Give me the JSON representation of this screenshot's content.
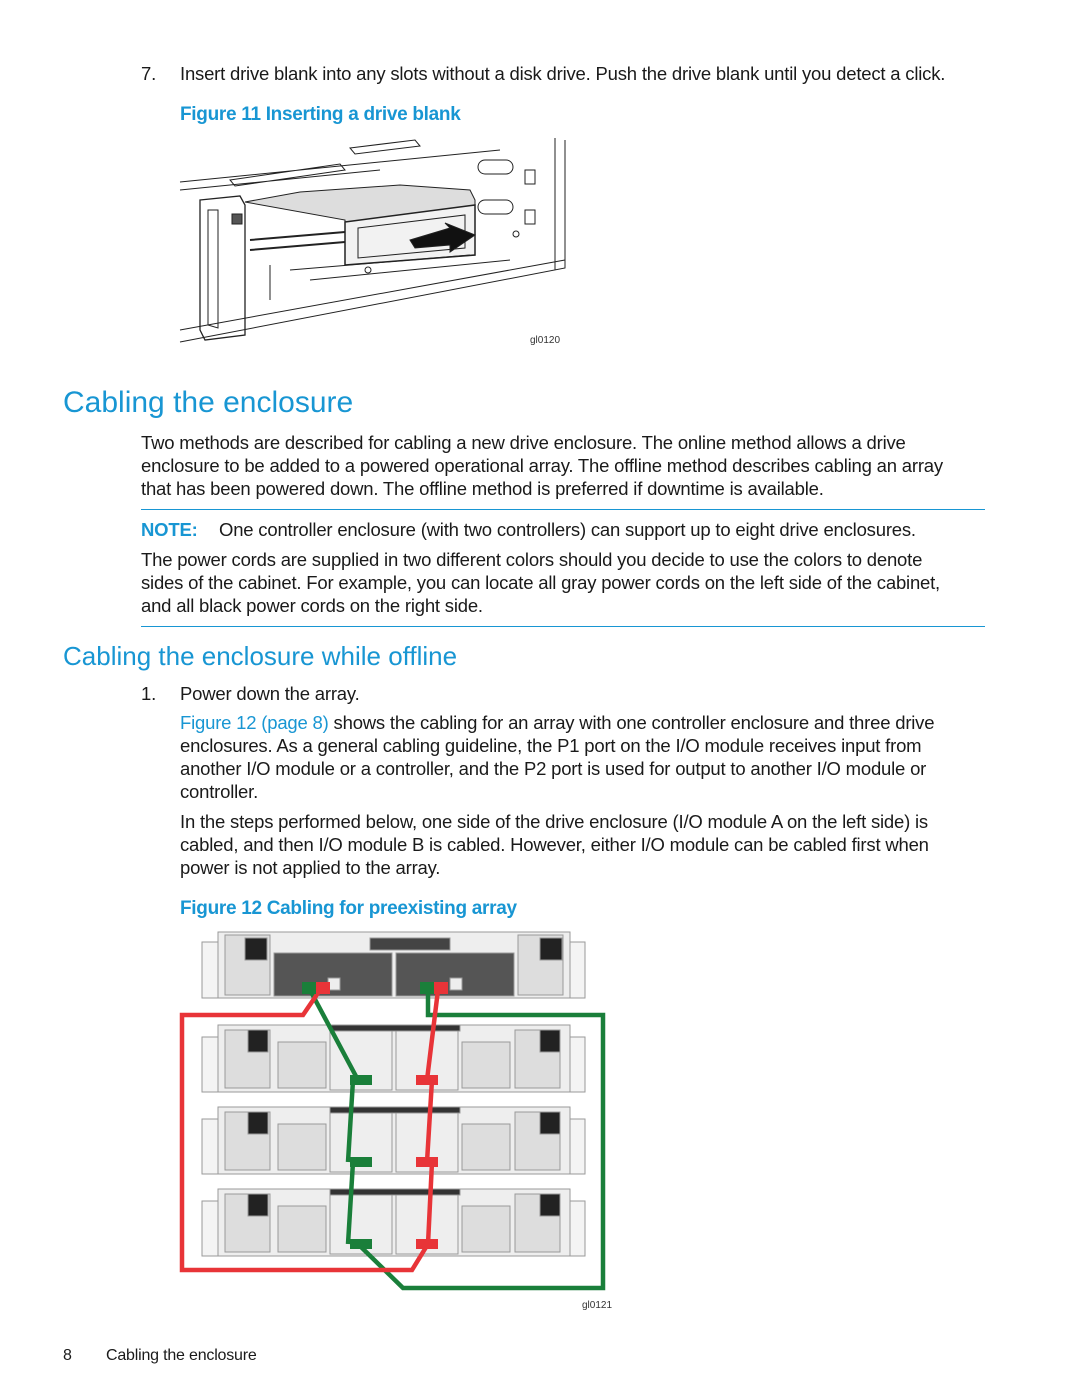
{
  "step7": {
    "number": "7.",
    "text": "Insert drive blank into any slots without a disk drive. Push the drive blank until you detect a click."
  },
  "figure11": {
    "caption": "Figure 11 Inserting a drive blank",
    "image_id": "gl0120"
  },
  "section1": {
    "title": "Cabling the enclosure",
    "intro_lines": [
      "Two methods are described for cabling a new drive enclosure. The online method allows a drive",
      "enclosure to be added to a powered operational array. The offline method describes cabling an array",
      "that has been powered down. The offline method is preferred if downtime is available."
    ],
    "note_label": "NOTE:",
    "note_text": "One controller enclosure (with two controllers) can support up to eight drive enclosures.",
    "note_body_lines": [
      "The power cords are supplied in two different colors should you decide to use the colors to denote",
      "sides of the cabinet. For example, you can locate all gray power cords on the left side of the cabinet,",
      "and all black power cords on the right side."
    ]
  },
  "section2": {
    "title": "Cabling the enclosure while offline",
    "step1_number": "1.",
    "step1_text": "Power down the array.",
    "para1_link": "Figure 12 (page 8)",
    "para1_lines": [
      " shows the cabling for an array with one controller enclosure and three drive",
      "enclosures. As a general cabling guideline, the P1 port on the I/O module receives input from",
      "another I/O module or a controller, and the P2 port is used for output to another I/O module or",
      "controller."
    ],
    "para2_lines": [
      "In the steps performed below, one side of the drive enclosure (I/O module A on the left side) is",
      "cabled, and then I/O module B is cabled. However, either I/O module can be cabled first when",
      "power is not applied to the array."
    ]
  },
  "figure12": {
    "caption": "Figure 12 Cabling for preexisting array",
    "image_id": "gl0121",
    "cable_colors": {
      "side_a": "#1a7f3a",
      "side_b": "#e83438"
    }
  },
  "footer": {
    "page_number": "8",
    "section": "Cabling the enclosure"
  },
  "colors": {
    "accent": "#1896d3",
    "text": "#1a1a1a"
  }
}
